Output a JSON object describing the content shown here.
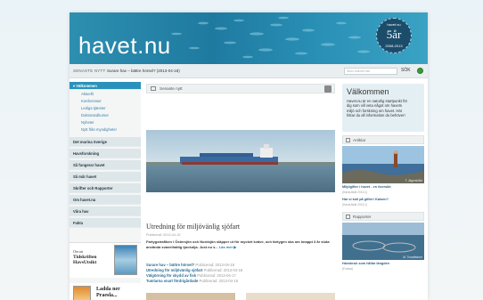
{
  "header": {
    "logo": "havet.nu",
    "badge_small": "havet.nu",
    "badge_big": "5år",
    "badge_years": "2008-2013"
  },
  "newsbar": {
    "label": "SENASTE NYTT",
    "headline": "Surare hav – bättre hörsel? (2013-04-18)",
    "search_placeholder": "Skriv sökord här",
    "search_button": "SÖK"
  },
  "sidebar": {
    "section": "Välkommen",
    "sub_items": [
      "Aktuellt",
      "Konferenser",
      "Lediga tjänster",
      "Doktorandkurser",
      "Nyheter",
      "Nytt från myndigheter"
    ],
    "main_items": [
      "Det marina Sverige",
      "Havsforskning",
      "Så fungerar havet",
      "Så mår havet",
      "Skrifter och Rapporter",
      "Om havet.nu",
      "Våra hav",
      "Fakta"
    ]
  },
  "ads": {
    "ad1_line1": "Om att",
    "ad1_title": "Tidskriften HavsUtsikt",
    "ad2_title": "Ladda ner Praesla..."
  },
  "main": {
    "section_label": "Senaste nytt",
    "story_title": "Utredning för miljövänlig sjöfart",
    "story_date": "Publicerat: 2013-04-19",
    "story_lead": "Fartygstrafiken i Östersjön och Nordsjön släpper ut för mycket kväve, och fartygen ska om knappt 3 år sluta använda svavelhaltig tjockolja. Just nu s...",
    "more_link": "Läs mer ▶",
    "news": [
      {
        "title": "Surare hav – bättre hörsel?",
        "pub": "Publicerad: 2013-04-18"
      },
      {
        "title": "Utredning för miljövänlig sjöfart",
        "pub": "Publicerad: 2013-04-18"
      },
      {
        "title": "Välgörning för skydd av fisk",
        "pub": "Publicerad: 2013-04-17"
      },
      {
        "title": "Tumlarna snart fördrigårdade",
        "pub": "Publicerad: 2013-04-16"
      }
    ]
  },
  "right": {
    "welcome_title": "Välkommen",
    "welcome_text": "Havet.nu är en naturlig startpunkt för dig som vill veta något om havets miljö och forskning om havet. Här hittar du all information du behöver!",
    "articles_label": "Artiklar",
    "article1_credit": "T. Jägerskiöld",
    "article1_title": "Miljögifter i havet - en översikt",
    "article1_meta": "(HavsUtsikt 2013:1)",
    "article2_title": "Har vi koll på giftet i Kaisen?",
    "article2_meta": "(HavsUtsikt 2013:1)",
    "reports_label": "Rapporter",
    "report1_credit": "M. Trosellstrom",
    "report1_title": "Havsbruk som hållar längden",
    "report1_meta": "(Forbus)"
  },
  "colors": {
    "banner": "#1f7aa0",
    "nav_active": "#2a91bd",
    "link": "#2a6f95"
  }
}
